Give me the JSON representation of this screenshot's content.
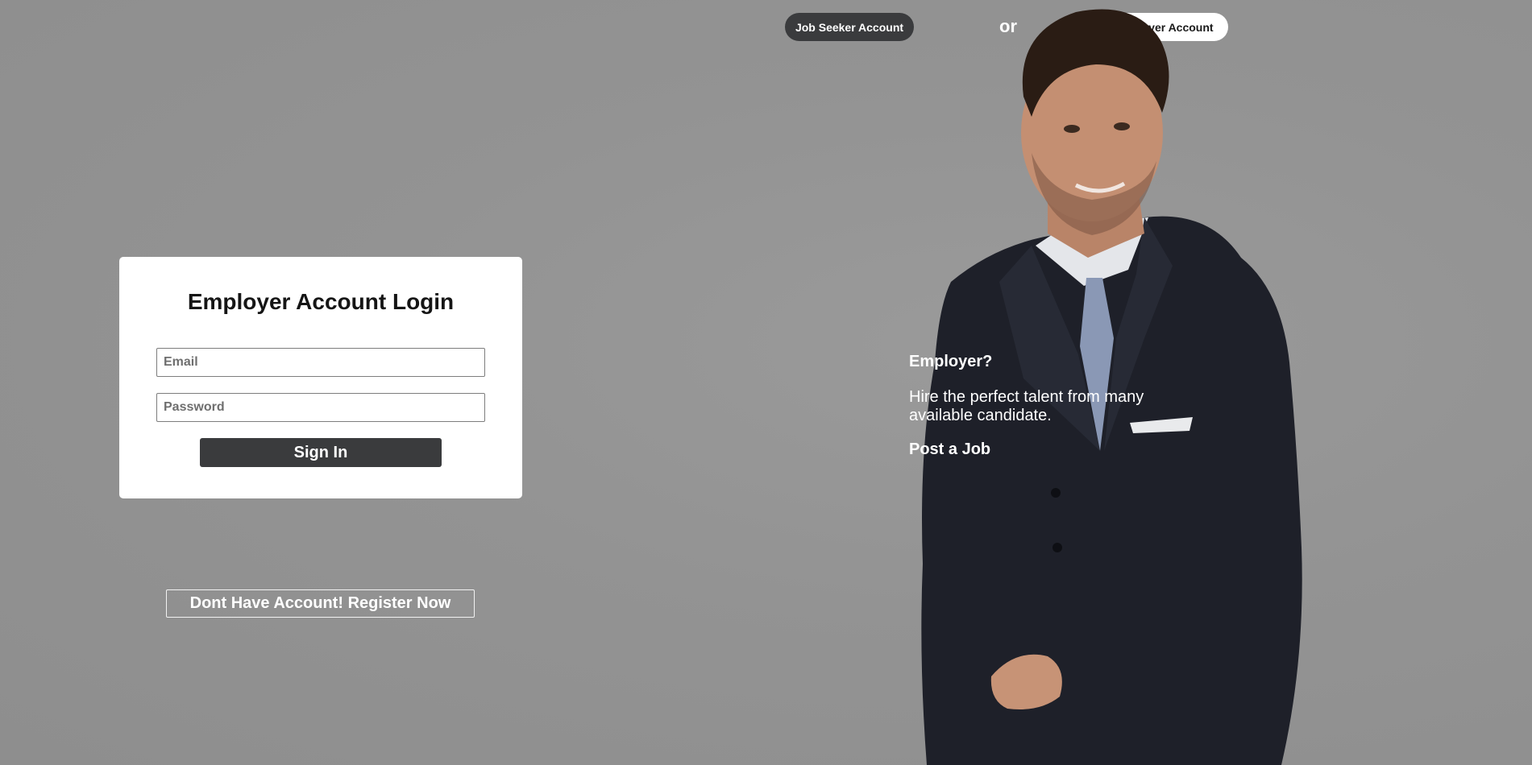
{
  "account_toggle": {
    "job_seeker_label": "Job Seeker Account",
    "separator": "or",
    "employer_label": "Employer Account"
  },
  "login": {
    "title": "Employer Account Login",
    "email_placeholder": "Email",
    "password_placeholder": "Password",
    "submit_label": "Sign In"
  },
  "register_label": "Dont Have Account! Register Now",
  "promo": {
    "heading": "Employer?",
    "description": "Hire the perfect talent from many available candidate.",
    "link": "Post a Job"
  },
  "colors": {
    "background": "#939393",
    "dark_button": "#3a3b3d",
    "card": "#ffffff",
    "text_light": "#ffffff"
  }
}
